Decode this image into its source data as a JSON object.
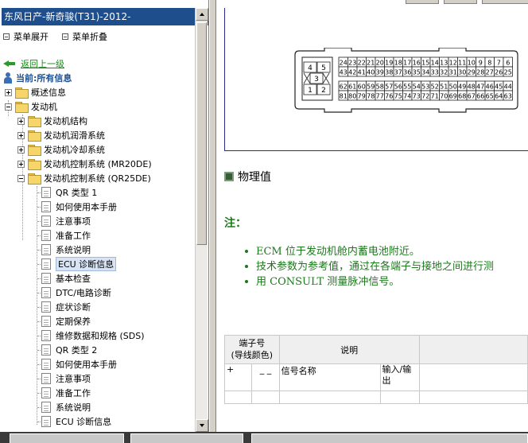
{
  "window": {
    "title": "东风日产-新奇骏(T31)-2012-"
  },
  "menu": {
    "expand_label": "菜单展开",
    "collapse_label": "菜单折叠"
  },
  "nav": {
    "back_label": "返回上一级",
    "current_label": "当前:所有信息"
  },
  "tree": {
    "overview": "概述信息",
    "engine": "发动机",
    "engine_children": {
      "mechanical": "发动机结构",
      "lubrication": "发动机润滑系统",
      "cooling": "发动机冷却系统",
      "control_mr20": "发动机控制系统 (MR20DE)",
      "control_qr25": "发动机控制系统 (QR25DE)"
    },
    "qr25_items": [
      "QR 类型 1",
      "如何使用本手册",
      "注意事项",
      "准备工作",
      "系统说明",
      "ECU 诊断信息",
      "基本检查",
      "DTC/电路诊断",
      "症状诊断",
      "定期保养",
      "维修数据和规格 (SDS)",
      "QR 类型 2",
      "如何使用本手册",
      "注意事项",
      "准备工作",
      "系统说明",
      "ECU 诊断信息"
    ],
    "selected_index": 5
  },
  "connector": {
    "small_block": [
      "4",
      "5",
      "3",
      "1",
      "2"
    ],
    "row1": [
      "24",
      "23",
      "22",
      "21",
      "20",
      "19",
      "18",
      "17",
      "16",
      "15",
      "14",
      "13",
      "12",
      "11",
      "10",
      "9",
      "8",
      "7",
      "6"
    ],
    "row2": [
      "43",
      "42",
      "41",
      "40",
      "39",
      "38",
      "37",
      "36",
      "35",
      "34",
      "33",
      "32",
      "31",
      "30",
      "29",
      "28",
      "27",
      "26",
      "25"
    ],
    "row3": [
      "62",
      "61",
      "60",
      "59",
      "58",
      "57",
      "56",
      "55",
      "54",
      "53",
      "52",
      "51",
      "50",
      "49",
      "48",
      "47",
      "46",
      "45",
      "44"
    ],
    "row4": [
      "81",
      "80",
      "79",
      "78",
      "77",
      "76",
      "75",
      "74",
      "73",
      "72",
      "71",
      "70",
      "69",
      "68",
      "67",
      "66",
      "65",
      "64",
      "63"
    ]
  },
  "content": {
    "section_title": "物理值",
    "note_title": "注：",
    "notes": [
      "ECM 位于发动机舱内蓄电池附近。",
      "技术参数为参考值，通过在各端子与接地之间进行测",
      "用  CONSULT 测量脉冲信号。"
    ],
    "table": {
      "col_terminal": "端子号\n(导线颜色)",
      "col_desc": "说明",
      "sub_plus": "+",
      "sub_minus": "_ _",
      "sub_signal": "信号名称",
      "sub_io": "输入/输出"
    }
  },
  "colors": {
    "title_bar": "#1e4f8c",
    "note_green": "#1a7a1a",
    "link_green": "#1a8a1a"
  }
}
